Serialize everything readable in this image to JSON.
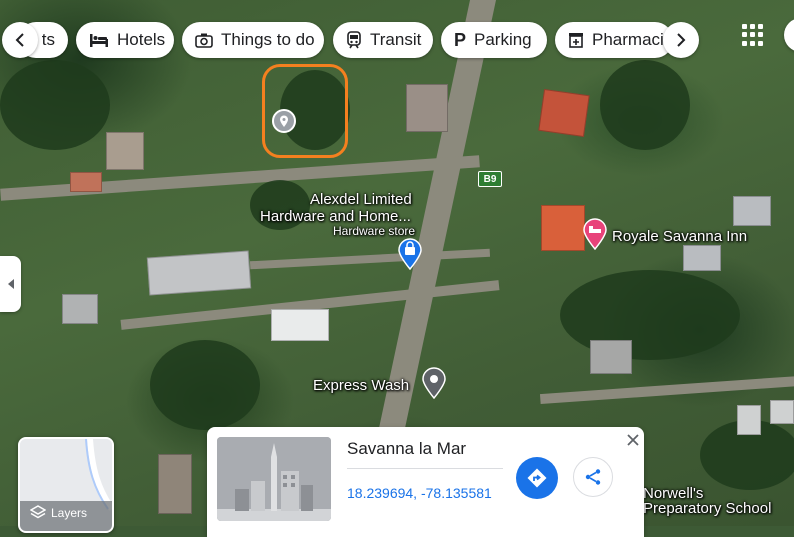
{
  "chips": {
    "partial_first": "ts",
    "items": [
      {
        "label": "Hotels",
        "icon": "bed-icon"
      },
      {
        "label": "Things to do",
        "icon": "camera-icon"
      },
      {
        "label": "Transit",
        "icon": "train-icon"
      },
      {
        "label": "Parking",
        "icon": "parking-icon"
      },
      {
        "label": "Pharmaci",
        "icon": "pharmacy-icon"
      }
    ]
  },
  "map": {
    "road_shield": "B9",
    "labels": {
      "alexdel_line1": "Alexdel Limited",
      "alexdel_line2": "Hardware and Home...",
      "alexdel_category": "Hardware store",
      "royale": "Royale Savanna Inn",
      "express_wash": "Express Wash",
      "norwells_line1": "Norwell's",
      "norwells_line2": "Preparatory School"
    },
    "colors": {
      "selection_outline": "#f4801f",
      "shopping_pin": "#1a73e8",
      "hotel_pin": "#e8437a",
      "generic_pin": "#5f6368"
    }
  },
  "layers": {
    "label": "Layers"
  },
  "place_card": {
    "title": "Savanna la Mar",
    "coordinates": "18.239694, -78.135581",
    "accent": "#1a73e8"
  }
}
